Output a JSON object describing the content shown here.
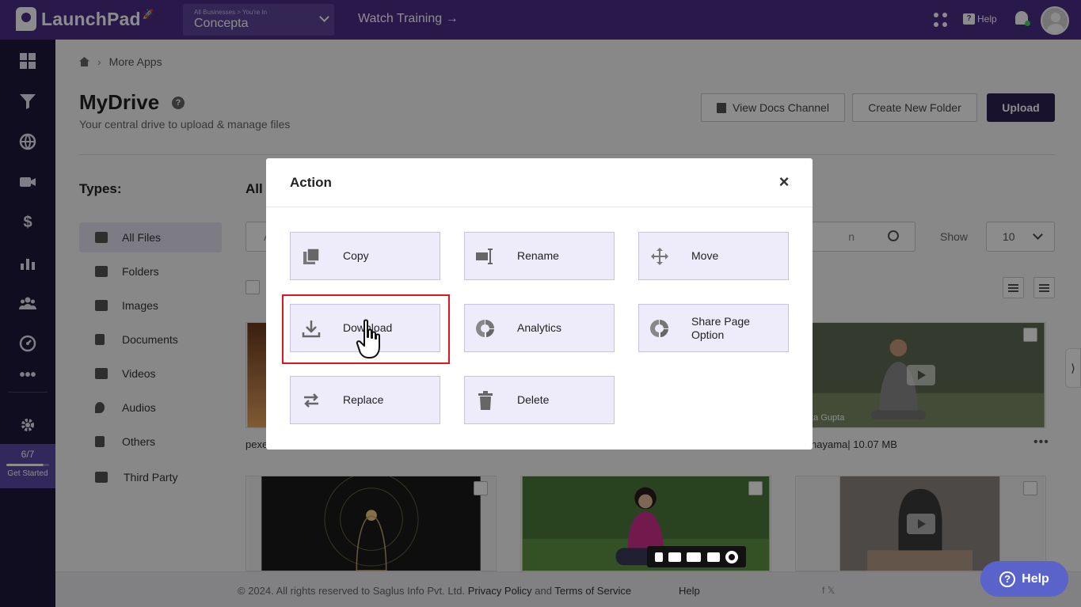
{
  "topbar": {
    "app_name": "LaunchPad",
    "business_breadcrumb": "All Businesses > You're In",
    "business_name": "Concepta",
    "watch_training": "Watch Training →",
    "help_label": "Help",
    "colors": {
      "bar": "#4b2f87",
      "accent": "#5e4aa8"
    }
  },
  "sidebar": {
    "icons": [
      "dashboard-icon",
      "funnel-icon",
      "globe-icon",
      "video-icon",
      "dollar-icon",
      "chart-icon",
      "users-icon",
      "gauge-icon",
      "more-icon",
      "gear-icon"
    ],
    "get_started": {
      "count": "6/7",
      "label": "Get Started",
      "progress": 0.86
    }
  },
  "breadcrumb": {
    "current": "More Apps"
  },
  "page": {
    "title": "MyDrive",
    "subtitle": "Your central drive to upload & manage files",
    "btn_docs": "View Docs Channel",
    "btn_new_folder": "Create New Folder",
    "btn_upload": "Upload"
  },
  "types": {
    "title": "Types:",
    "items": [
      "All Files",
      "Folders",
      "Images",
      "Documents",
      "Videos",
      "Audios",
      "Others",
      "Third Party"
    ]
  },
  "files": {
    "heading": "All",
    "search_placeholder": "A",
    "search_tail": "n",
    "show_label": "Show",
    "show_value": "10",
    "cards": [
      {
        "caption": "pexe"
      },
      {
        "caption": "nayama| 10.07 MB",
        "watermark": "dhika Gupta"
      }
    ]
  },
  "footer": {
    "copyright": "©  2024. All rights reserved to Saglus Info Pvt. Ltd.",
    "privacy": "Privacy Policy",
    "and": "and",
    "terms": "Terms of Service",
    "help": "Help",
    "social": "f  𝕏"
  },
  "help_float": "Help",
  "modal": {
    "title": "Action",
    "close": "×",
    "actions": {
      "copy": "Copy",
      "rename": "Rename",
      "move": "Move",
      "download": "Download",
      "analytics": "Analytics",
      "share": "Share Page Option",
      "replace": "Replace",
      "delete": "Delete"
    }
  }
}
